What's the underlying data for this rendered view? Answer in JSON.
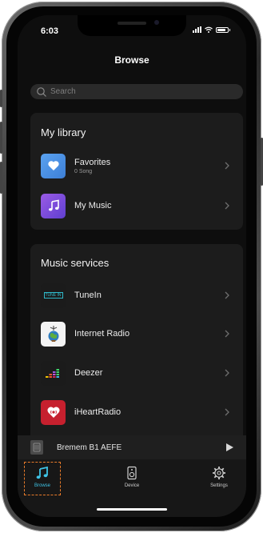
{
  "status_bar": {
    "time": "6:03"
  },
  "header": {
    "title": "Browse"
  },
  "search": {
    "placeholder": "Search"
  },
  "library": {
    "title": "My library",
    "items": [
      {
        "label": "Favorites",
        "sublabel": "0 Song",
        "icon": "heart-icon",
        "color": "#4a8de0"
      },
      {
        "label": "My Music",
        "icon": "music-note-icon",
        "color": "#7b4fd8"
      }
    ]
  },
  "services": {
    "title": "Music services",
    "items": [
      {
        "label": "TuneIn",
        "icon": "tunein-logo",
        "logo_text": "TUNE IN"
      },
      {
        "label": "Internet Radio",
        "icon": "globe-antenna-icon"
      },
      {
        "label": "Deezer",
        "icon": "deezer-logo"
      },
      {
        "label": "iHeartRadio",
        "icon": "iheartradio-logo",
        "color": "#c6202e"
      }
    ]
  },
  "mini_player": {
    "title": "Bremem B1 AEFE"
  },
  "tabs": [
    {
      "label": "Browse",
      "icon": "music-note-icon",
      "active": true
    },
    {
      "label": "Device",
      "icon": "speaker-icon",
      "active": false
    },
    {
      "label": "Settings",
      "icon": "gear-icon",
      "active": false
    }
  ],
  "colors": {
    "accent": "#3ec3e6",
    "highlight": "#e87b2a",
    "background": "#0e0e0e"
  }
}
